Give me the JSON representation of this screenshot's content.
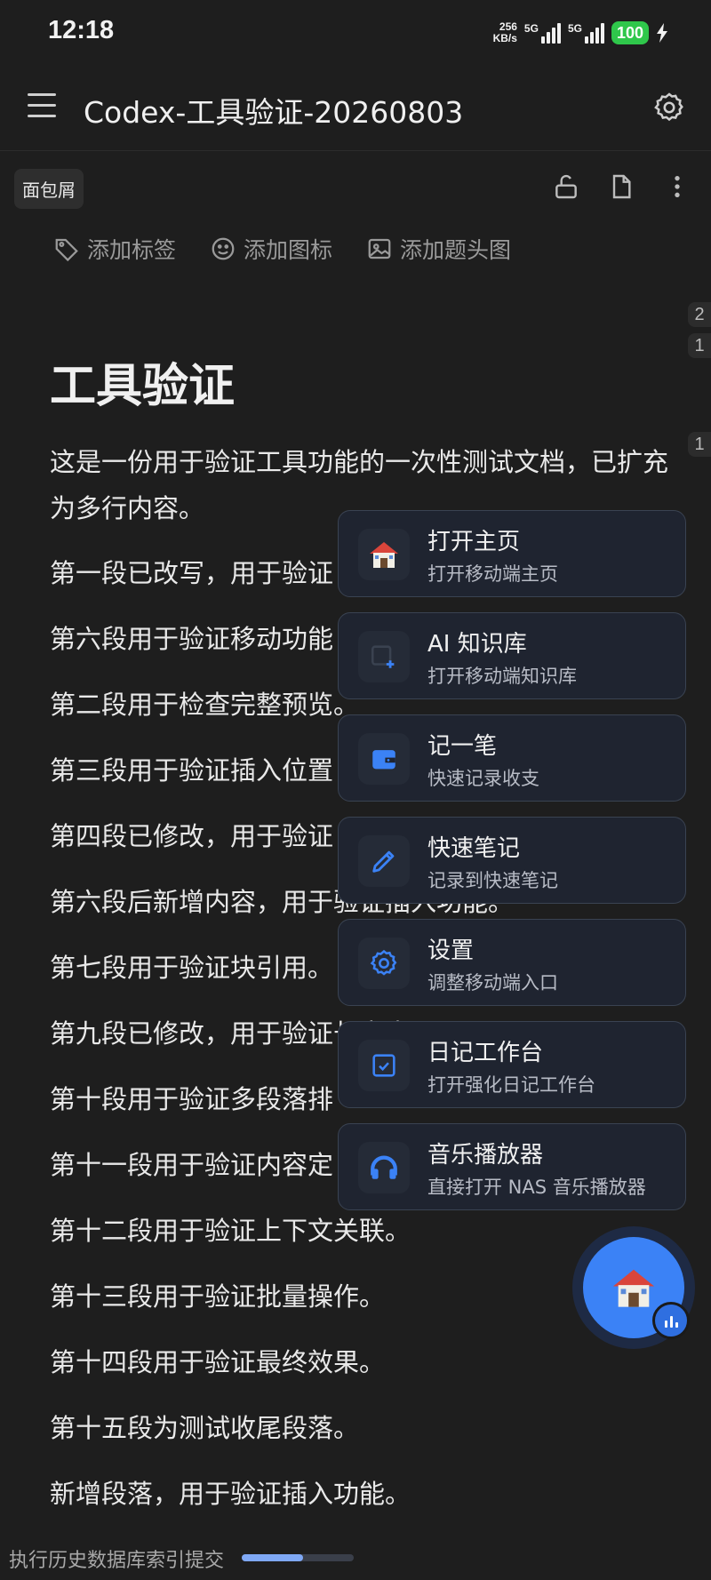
{
  "status_bar": {
    "time": "12:18",
    "speed_value": "256",
    "speed_unit": "KB/s",
    "network_1": "5G",
    "network_2": "5G",
    "battery": "100"
  },
  "app_bar": {
    "title": "Codex-工具验证-20260803",
    "menu_icon": "hamburger-menu-icon",
    "settings_icon": "gear-icon"
  },
  "toolbar": {
    "breadcrumb": "面包屑",
    "icons": [
      "unlock-icon",
      "document-icon",
      "more-vertical-icon"
    ]
  },
  "meta_actions": [
    {
      "icon": "tag-icon",
      "label": "添加标签"
    },
    {
      "icon": "smiley-icon",
      "label": "添加图标"
    },
    {
      "icon": "image-icon",
      "label": "添加题头图"
    }
  ],
  "gutter_markers": [
    "2",
    "1",
    "1"
  ],
  "document": {
    "title": "工具验证",
    "intro": "这是一份用于验证工具功能的一次性测试文档，已扩充为多行内容。",
    "paragraphs": [
      "第一段已改写，用于验证",
      "第六段用于验证移动功能",
      "第二段用于检查完整预览。",
      "第三段用于验证插入位置",
      "第四段已修改，用于验证",
      "第六段后新增内容，用于验证插入功能。",
      "第七段用于验证块引用。",
      "第九段已修改，用于验证长文本展示",
      "第十段用于验证多段落排",
      "第十一段用于验证内容定",
      "第十二段用于验证上下文关联。",
      "第十三段用于验证批量操作。",
      "第十四段用于验证最终效果。",
      "第十五段为测试收尾段落。",
      "新增段落，用于验证插入功能。"
    ]
  },
  "quick_menu": [
    {
      "icon": "home-icon",
      "title": "打开主页",
      "subtitle": "打开移动端主页"
    },
    {
      "icon": "knowledge-base-icon",
      "title": "AI 知识库",
      "subtitle": "打开移动端知识库"
    },
    {
      "icon": "wallet-icon",
      "title": "记一笔",
      "subtitle": "快速记录收支"
    },
    {
      "icon": "pencil-icon",
      "title": "快速笔记",
      "subtitle": "记录到快速笔记"
    },
    {
      "icon": "gear-icon",
      "title": "设置",
      "subtitle": "调整移动端入口"
    },
    {
      "icon": "calendar-check-icon",
      "title": "日记工作台",
      "subtitle": "打开强化日记工作台"
    },
    {
      "icon": "headphones-icon",
      "title": "音乐播放器",
      "subtitle": "直接打开 NAS 音乐播放器"
    }
  ],
  "fab": {
    "icon": "home-icon",
    "badge_icon": "equalizer-icon"
  },
  "bottom_status": {
    "text": "执行历史数据库索引提交",
    "progress": 0.55
  },
  "colors": {
    "background": "#1e1e1e",
    "accent": "#3b82f6",
    "card": "#1f2430",
    "battery": "#2fc74b"
  }
}
